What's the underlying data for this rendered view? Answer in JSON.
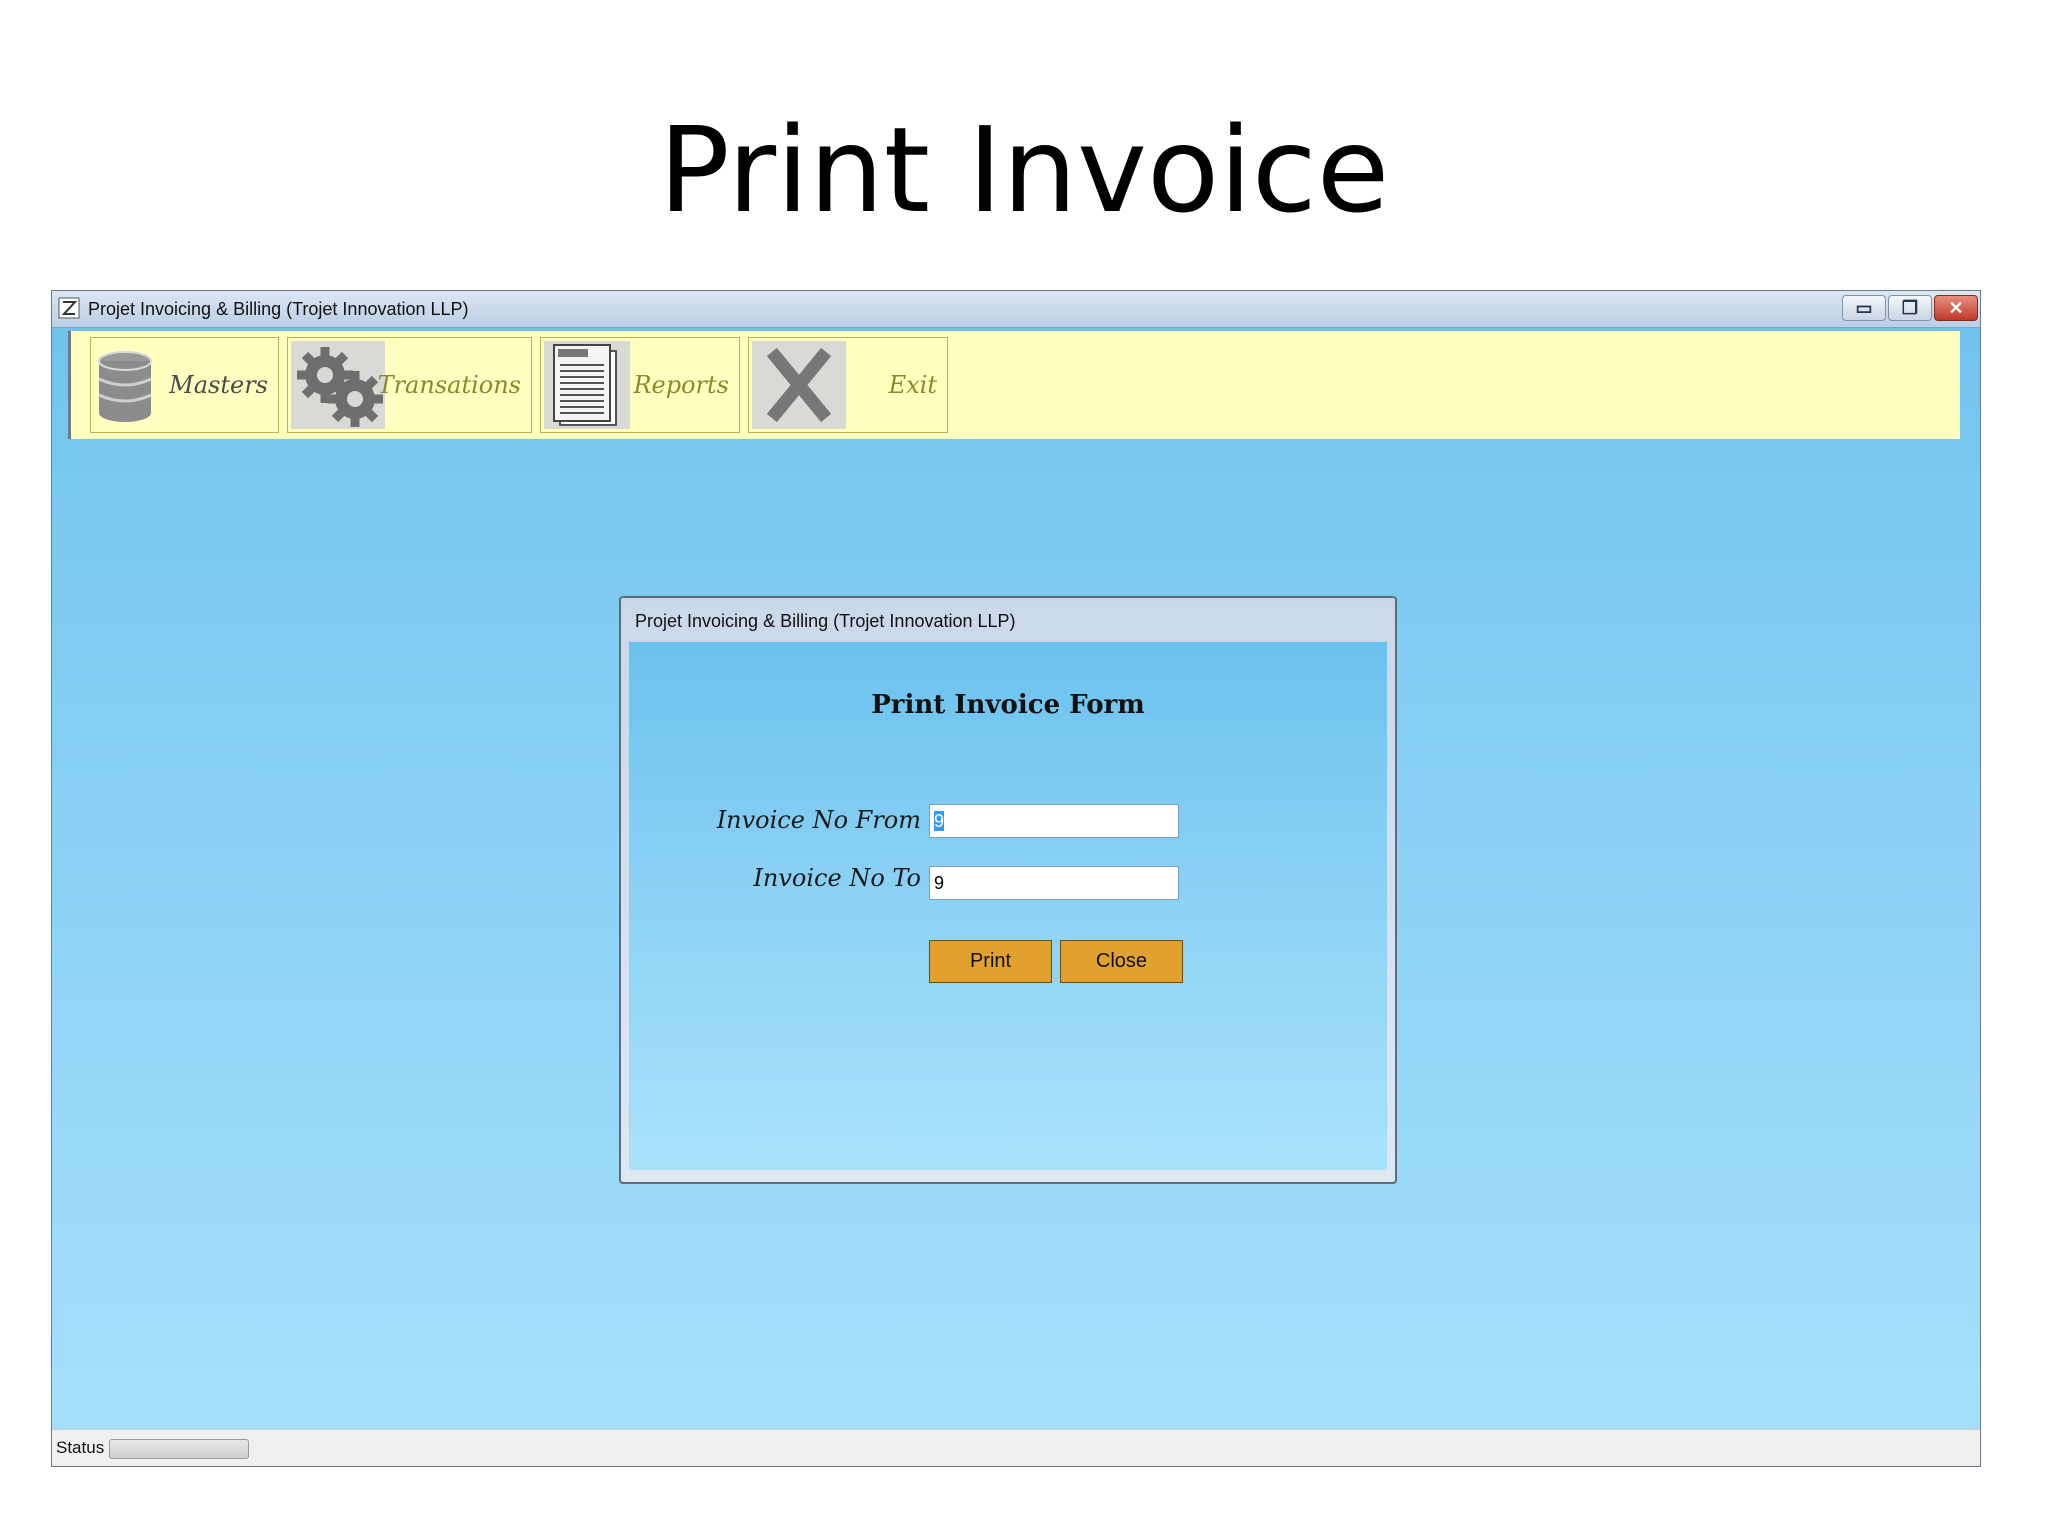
{
  "slide": {
    "title": "Print Invoice"
  },
  "window": {
    "title": "Projet Invoicing & Billing (Trojet Innovation LLP)",
    "controls": {
      "minimize": "▭",
      "restore": "❐",
      "close": "✕"
    }
  },
  "toolbar": {
    "masters": {
      "label": "Masters",
      "icon": "database-icon"
    },
    "transactions": {
      "label": "Transations",
      "icon": "gears-icon"
    },
    "reports": {
      "label": "Reports",
      "icon": "report-document-icon"
    },
    "exit": {
      "label": "Exit",
      "icon": "x-close-icon"
    },
    "background": "#ffffc0"
  },
  "dialog": {
    "title": "Projet Invoicing & Billing (Trojet Innovation LLP)",
    "heading": "Print Invoice Form",
    "fields": {
      "invoice_from": {
        "label": "Invoice No From",
        "value": "9"
      },
      "invoice_to": {
        "label": "Invoice No To",
        "value": "9"
      }
    },
    "buttons": {
      "print": "Print",
      "close": "Close"
    },
    "button_color": "#e2a12f"
  },
  "statusbar": {
    "label": "Status"
  }
}
